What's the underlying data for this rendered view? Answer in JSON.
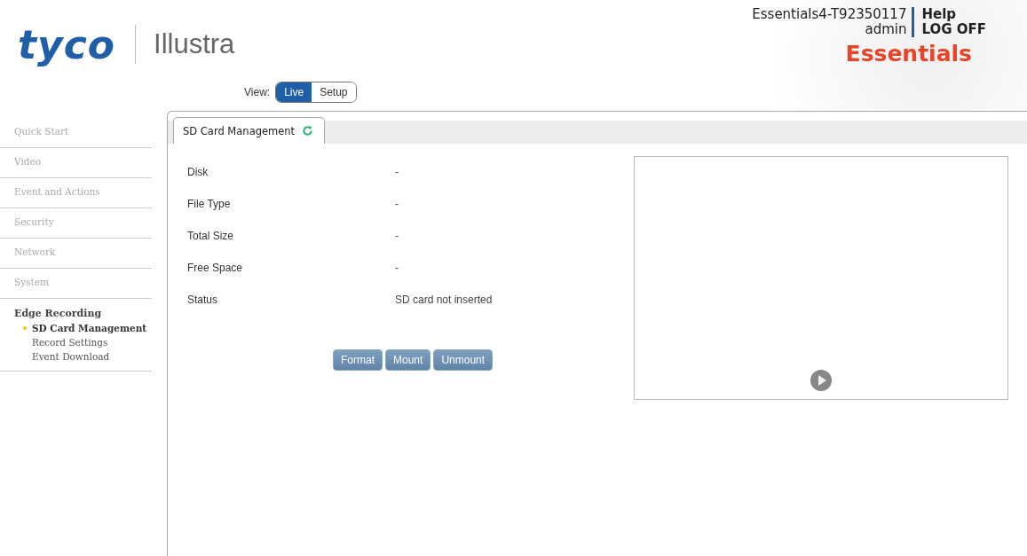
{
  "header": {
    "logo": "tyco",
    "product": "Illustra",
    "device_name": "Essentials4-T92350117",
    "user": "admin",
    "links": [
      "Help",
      "LOG OFF"
    ],
    "edition": "Essentials"
  },
  "view": {
    "label": "View:",
    "options": [
      {
        "label": "Live",
        "selected": true
      },
      {
        "label": "Setup",
        "selected": false
      }
    ]
  },
  "sidebar": {
    "items": [
      {
        "label": "Quick Start",
        "expanded": false
      },
      {
        "label": "Video",
        "expanded": false
      },
      {
        "label": "Event and Actions",
        "expanded": false
      },
      {
        "label": "Security",
        "expanded": false
      },
      {
        "label": "Network",
        "expanded": false
      },
      {
        "label": "System",
        "expanded": false
      },
      {
        "label": "Edge Recording",
        "expanded": true,
        "children": [
          {
            "label": "SD Card Management",
            "selected": true
          },
          {
            "label": "Record Settings",
            "selected": false
          },
          {
            "label": "Event Download",
            "selected": false
          }
        ]
      }
    ]
  },
  "tabs": [
    {
      "label": "SD Card Management",
      "selected": true
    }
  ],
  "fields": [
    {
      "label": "Disk",
      "value": "-"
    },
    {
      "label": "File Type",
      "value": "-"
    },
    {
      "label": "Total Size",
      "value": "-"
    },
    {
      "label": "Free Space",
      "value": "-"
    },
    {
      "label": "Status",
      "value": "SD card not inserted"
    }
  ],
  "buttons": [
    {
      "label": "Format",
      "disabled": true
    },
    {
      "label": "Mount",
      "disabled": true
    },
    {
      "label": "Unmount",
      "disabled": true
    }
  ]
}
